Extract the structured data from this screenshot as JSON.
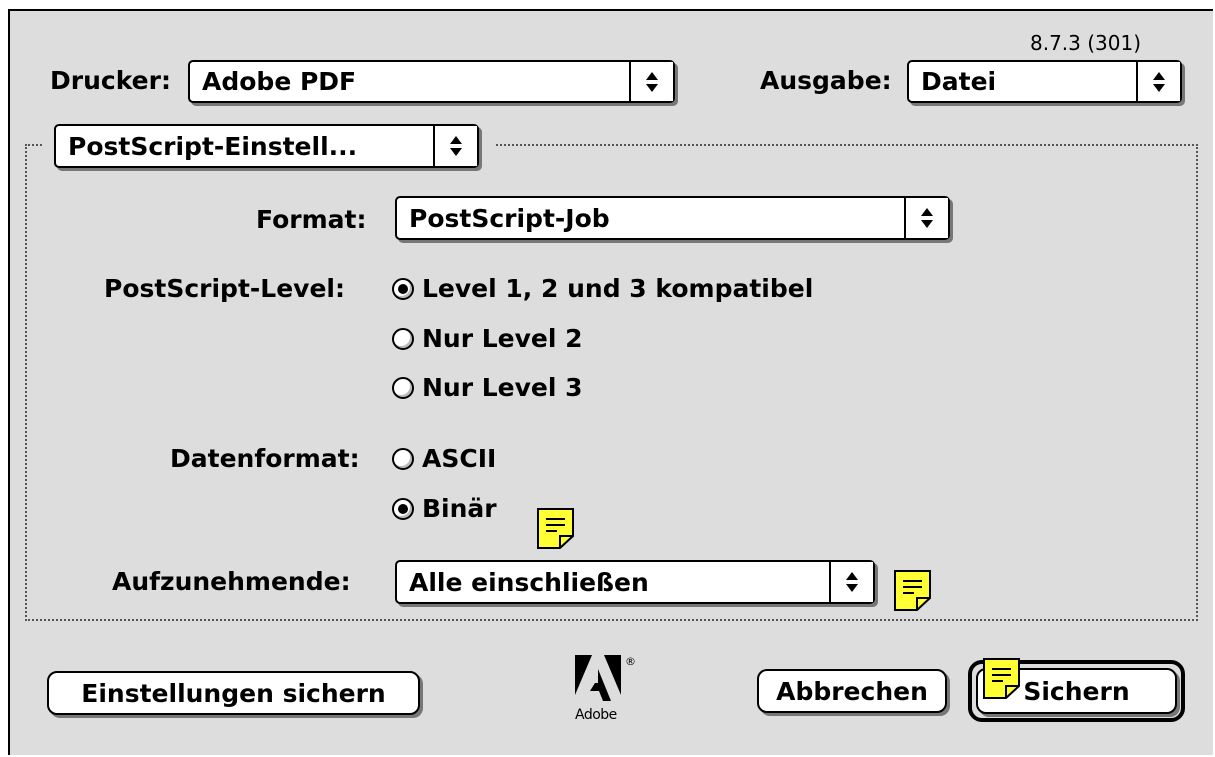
{
  "version": "8.7.3 (301)",
  "printer": {
    "label": "Drucker:",
    "value": "Adobe PDF"
  },
  "output": {
    "label": "Ausgabe:",
    "value": "Datei"
  },
  "group": {
    "value": "PostScript-Einstell..."
  },
  "format": {
    "label": "Format:",
    "value": "PostScript-Job"
  },
  "ps_level": {
    "label": "PostScript-Level:",
    "options": [
      {
        "label": "Level 1, 2 und 3 kompatibel",
        "selected": true
      },
      {
        "label": "Nur Level 2",
        "selected": false
      },
      {
        "label": "Nur Level 3",
        "selected": false
      }
    ]
  },
  "data_format": {
    "label": "Datenformat:",
    "options": [
      {
        "label": "ASCII",
        "selected": false
      },
      {
        "label": "Binär",
        "selected": true
      }
    ]
  },
  "fonts": {
    "label": "Aufzunehmende:",
    "value": "Alle einschließen"
  },
  "buttons": {
    "save_settings": "Einstellungen sichern",
    "cancel": "Abbrechen",
    "save": "Sichern"
  },
  "logo": {
    "text": "Adobe",
    "mark": "®"
  },
  "colors": {
    "dialog_bg": "#dddddd",
    "note_yellow": "#ffff33"
  },
  "icons": {
    "popup_arrow": "up-down-arrows-icon",
    "note": "sticky-note-icon"
  }
}
